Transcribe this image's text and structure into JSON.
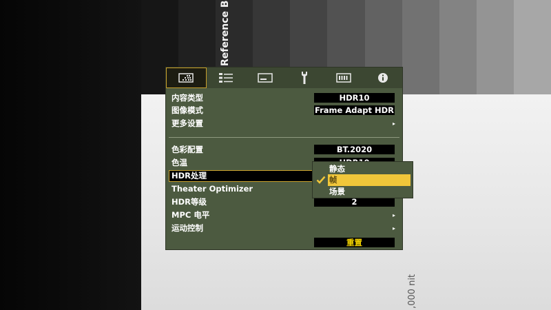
{
  "background": {
    "reference_text": "Reference Bla",
    "nit_text": ",000 nit",
    "bar_colors": [
      "#161616",
      "#202020",
      "#2b2b2b",
      "#373737",
      "#444444",
      "#525252",
      "#626262",
      "#727272",
      "#838383",
      "#949494",
      "#a7a7a7"
    ]
  },
  "menu": {
    "tabs": [
      {
        "name": "picture-icon",
        "active": true
      },
      {
        "name": "input-icon",
        "active": false
      },
      {
        "name": "display-icon",
        "active": false
      },
      {
        "name": "wrench-icon",
        "active": false
      },
      {
        "name": "function-icon",
        "active": false
      },
      {
        "name": "info-icon",
        "active": false
      }
    ],
    "items": [
      {
        "label": "内容类型",
        "value": "HDR10"
      },
      {
        "label": "图像模式",
        "value": "Frame Adapt HDR"
      },
      {
        "label": "更多设置",
        "arrow": "▸"
      },
      {
        "label": "色彩配置",
        "value": "BT.2020"
      },
      {
        "label": "色温",
        "value": "HDR10"
      },
      {
        "label": "HDR处理"
      },
      {
        "label": "Theater Optimizer"
      },
      {
        "label": "HDR等级",
        "value": "2"
      },
      {
        "label": "MPC 电平",
        "arrow": "▸"
      },
      {
        "label": "运动控制",
        "arrow": "▸"
      }
    ],
    "reset_label": "重置"
  },
  "popup": {
    "options": [
      "静态",
      "帧",
      "场景"
    ],
    "selected_index": 1,
    "highlight_color": "#f0c63a",
    "check_color": "#f0c63a"
  },
  "colors": {
    "menu_bg": "#4c5a40",
    "accent_border": "#c9a02c",
    "reset_text": "#f1d200"
  }
}
